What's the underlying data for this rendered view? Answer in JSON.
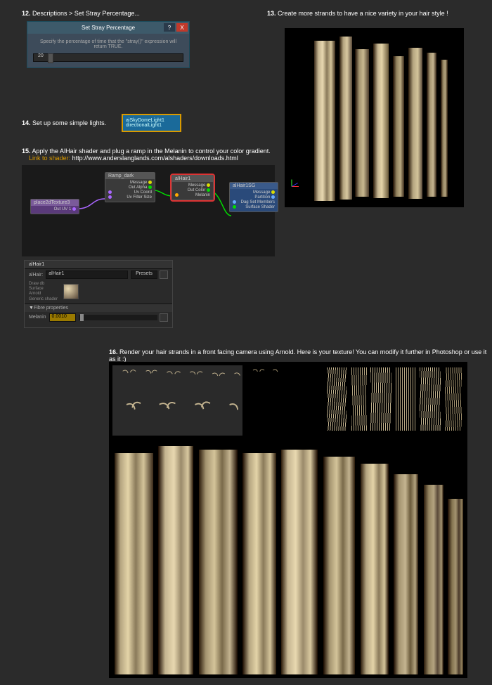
{
  "step12": {
    "num": "12.",
    "text": "Descriptions > Set Stray Percentage..."
  },
  "step13": {
    "num": "13.",
    "text": "Create more strands to have a nice variety in your hair style !"
  },
  "step14": {
    "num": "14.",
    "text": "Set up some simple lights."
  },
  "step15": {
    "num": "15.",
    "text": "Apply the AlHair shader and plug a ramp in the Melanin to control your color gradient.",
    "link_label": "Link to shader:",
    "link_url": "http://www.anderslanglands.com/alshaders/downloads.html"
  },
  "step16": {
    "num": "16.",
    "text": "Render your hair strands in a front facing camera using Arnold. Here is your texture! You can modify it further in Photoshop or use it as it :)"
  },
  "dialog": {
    "title": "Set Stray Percentage",
    "help": "?",
    "close": "X",
    "body": "Specify the percentage of time that the \"stray()\" expression will return TRUE.",
    "value": "20"
  },
  "lights": {
    "l1": "aiSkyDomeLight1",
    "l2": "directionalLight1"
  },
  "nodes": {
    "n1": {
      "name": "place2dTexture3",
      "r1": "Out UV 1"
    },
    "n2": {
      "name": "Ramp_dark",
      "r1": "Message",
      "r2": "Out Alpha",
      "r3": "Uv Coord",
      "r4": "Uv Filter Size"
    },
    "n3": {
      "name": "alHair1",
      "r1": "Message",
      "r2": "Out Color",
      "r3": "Melanin"
    },
    "n4": {
      "name": "alHair1SG",
      "r1": "Message",
      "r2": "Partition",
      "r3": "Dag Set Members",
      "r4": "Surface Shader"
    }
  },
  "attr": {
    "tab": "alHair1",
    "field_label": "alHair:",
    "field_val": "alHair1",
    "presets": "Presets",
    "types": {
      "a": "Draw db",
      "b": "Surface",
      "c": "Arnold",
      "d": "Generic shader"
    },
    "section": "Fibre properties",
    "prop_label": "Melanin",
    "prop_val": "0.0010"
  }
}
